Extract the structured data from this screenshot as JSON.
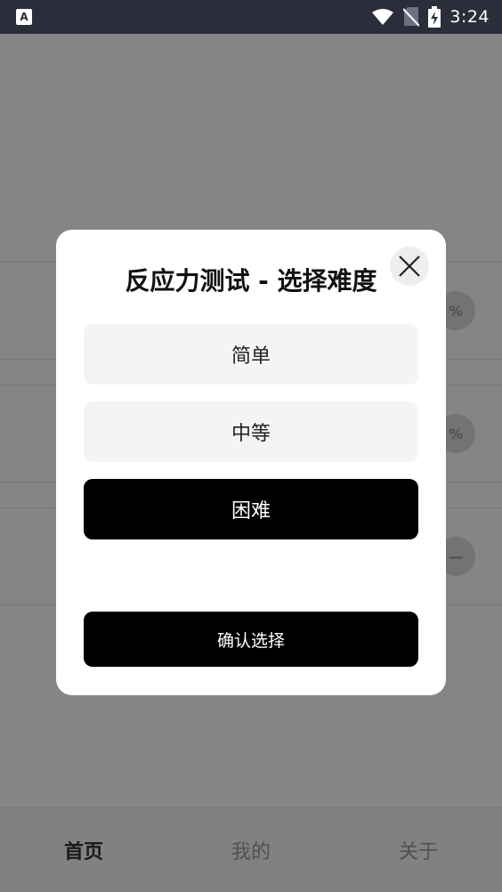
{
  "status_bar": {
    "app_icon_letter": "A",
    "time": "3:24",
    "icons": [
      "wifi-icon",
      "no-sim-icon",
      "battery-charging-icon"
    ]
  },
  "background": {
    "cards": [
      {
        "icon_text": "%"
      },
      {
        "icon_text": "%"
      },
      {
        "icon_text": "—"
      }
    ],
    "tabs": [
      {
        "label": "首页",
        "active": true
      },
      {
        "label": "我的",
        "active": false
      },
      {
        "label": "关于",
        "active": false
      }
    ]
  },
  "dialog": {
    "title": "反应力测试 - 选择难度",
    "close_icon": "close-icon",
    "options": [
      {
        "label": "简单",
        "selected": false
      },
      {
        "label": "中等",
        "selected": false
      },
      {
        "label": "困难",
        "selected": true
      }
    ],
    "confirm_label": "确认选择"
  },
  "colors": {
    "status_bar_bg": "#2b2d3a",
    "selected_option_bg": "#000000",
    "option_bg": "#f4f4f4"
  }
}
